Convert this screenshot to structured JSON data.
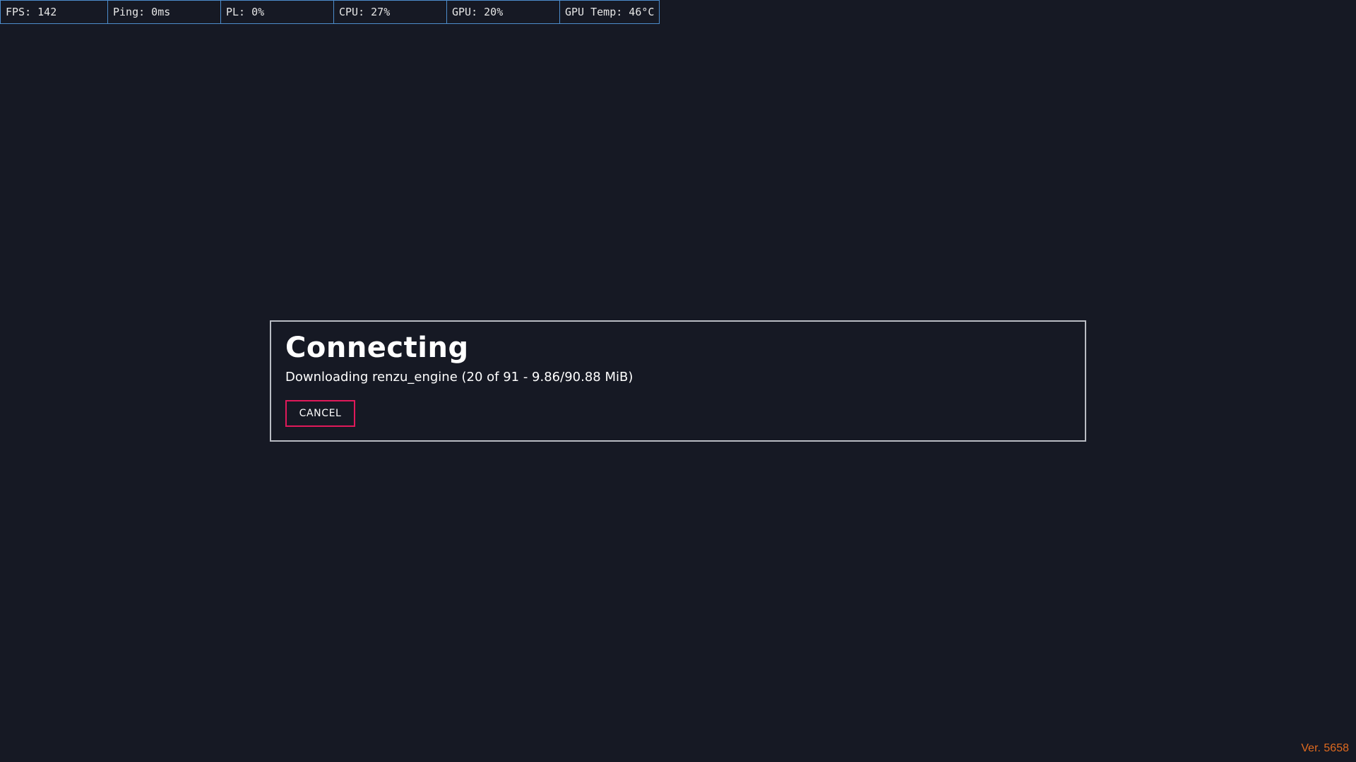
{
  "perf_overlay": {
    "fps": "FPS: 142",
    "ping": "Ping: 0ms",
    "packet_loss": "PL: 0%",
    "cpu": "CPU: 27%",
    "gpu": "GPU: 20%",
    "gpu_temp": "GPU Temp: 46°C"
  },
  "dialog": {
    "title": "Connecting",
    "status": "Downloading renzu_engine (20 of 91 - 9.86/90.88 MiB)",
    "cancel_label": "CANCEL"
  },
  "version": "Ver. 5658",
  "colors": {
    "background": "#161924",
    "overlay_border": "#4d8ccc",
    "dialog_border": "#b9bcc3",
    "cancel_border": "#e0195a",
    "version_text": "#e06a1f"
  }
}
